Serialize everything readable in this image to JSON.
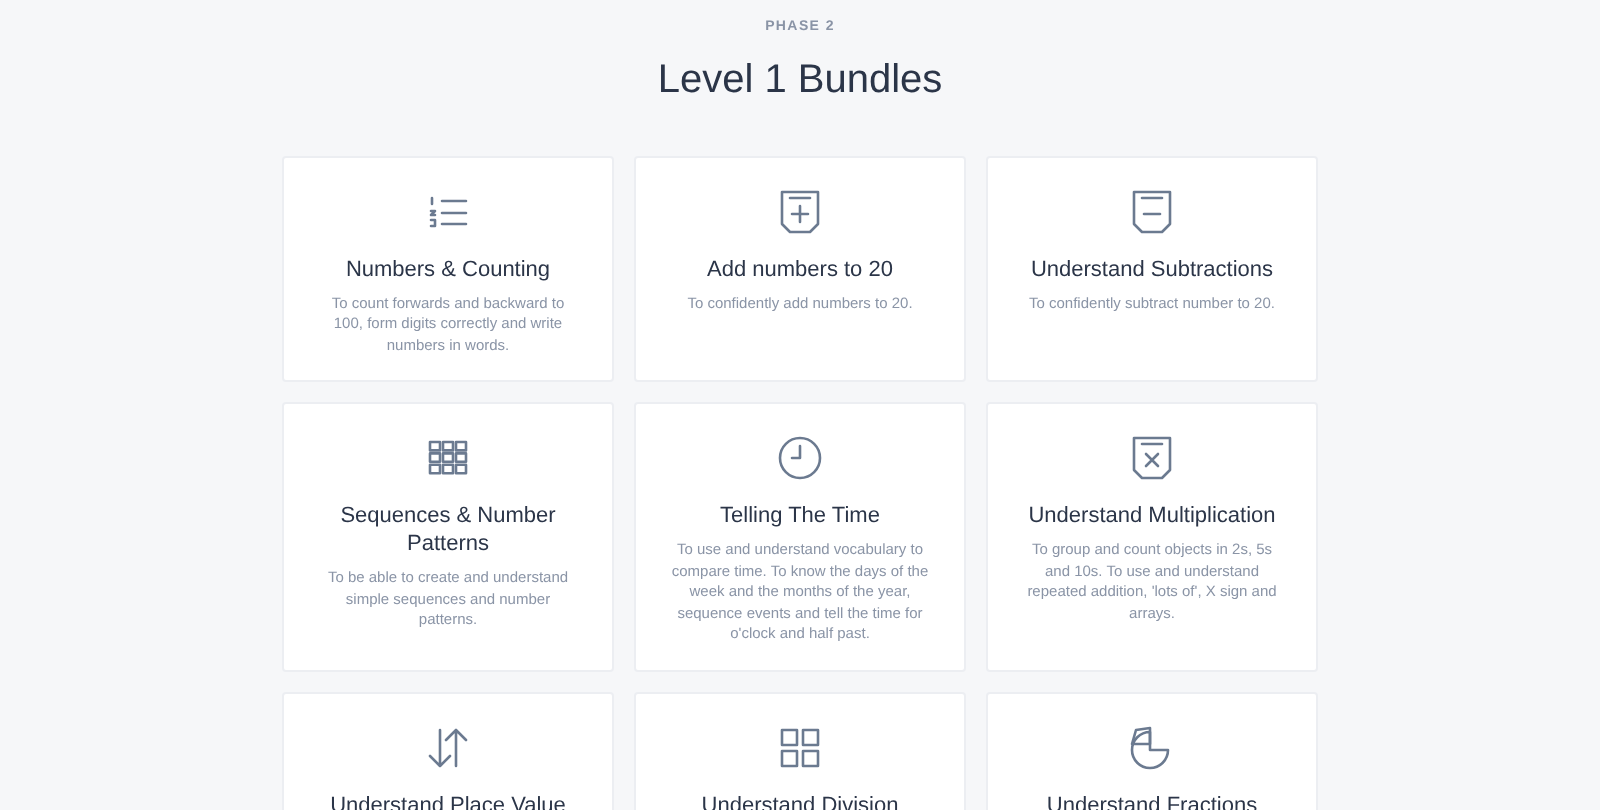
{
  "eyebrow": "PHASE 2",
  "heading": "Level 1 Bundles",
  "bundles": [
    {
      "title": "Numbers & Counting",
      "description": "To count forwards and backward to 100, form digits correctly and write numbers in words."
    },
    {
      "title": "Add numbers to 20",
      "description": "To confidently add numbers to 20."
    },
    {
      "title": "Understand Subtractions",
      "description": "To confidently subtract number to 20."
    },
    {
      "title": "Sequences & Number Patterns",
      "description": "To be able to create and understand simple sequences and number patterns."
    },
    {
      "title": "Telling The Time",
      "description": "To use and understand vocabulary to compare time. To know the days of the week and the months of the year, sequence events and tell the time for o'clock and half past."
    },
    {
      "title": "Understand Multiplication",
      "description": "To group and count objects in 2s, 5s and 10s. To use and understand repeated addition, 'lots of', X sign and arrays."
    },
    {
      "title": "Understand Place Value"
    },
    {
      "title": "Understand Division"
    },
    {
      "title": "Understand Fractions"
    }
  ]
}
